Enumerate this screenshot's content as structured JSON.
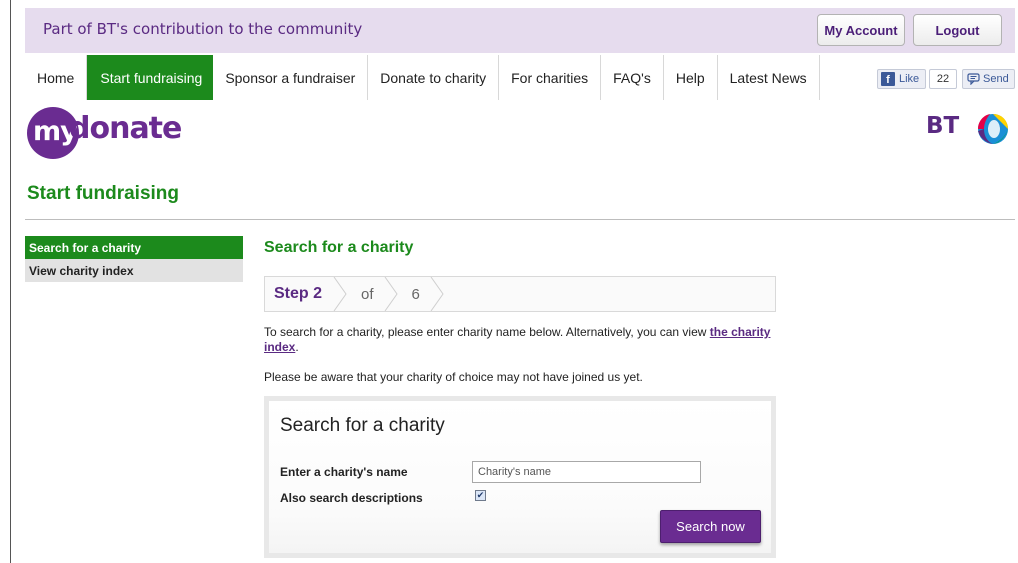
{
  "topbar": {
    "tagline": "Part of BT's contribution to the community",
    "my_account_label": "My Account",
    "logout_label": "Logout"
  },
  "nav": {
    "items": [
      "Home",
      "Start fundraising",
      "Sponsor a fundraiser",
      "Donate to charity",
      "For charities",
      "FAQ's",
      "Help",
      "Latest News"
    ],
    "active": "Start fundraising"
  },
  "social": {
    "like_label": "Like",
    "like_count": "22",
    "send_label": "Send"
  },
  "logo": {
    "my": "my",
    "donate": "donate",
    "bt": "BT"
  },
  "page": {
    "title": "Start fundraising"
  },
  "sidebar": {
    "items": [
      {
        "label": "Search for a charity",
        "active": true
      },
      {
        "label": "View charity index",
        "active": false
      }
    ]
  },
  "main": {
    "title": "Search for a charity",
    "steps": {
      "current": "Step 2",
      "of": "of",
      "total": "6"
    },
    "intro_text": "To search for a charity, please enter charity name below. Alternatively, you can view ",
    "intro_link": "the charity index",
    "intro_end": ".",
    "notice": "Please be aware that your charity of choice may not have joined us yet."
  },
  "search_form": {
    "title": "Search for a charity",
    "name_label": "Enter a charity's name",
    "name_placeholder": "Charity's name",
    "name_value": "",
    "desc_label": "Also search descriptions",
    "desc_checked": true,
    "submit_label": "Search now"
  },
  "colors": {
    "brand_purple": "#6a2c91",
    "accent_green": "#1c8a1c",
    "topbar_bg": "#e6dcee"
  }
}
